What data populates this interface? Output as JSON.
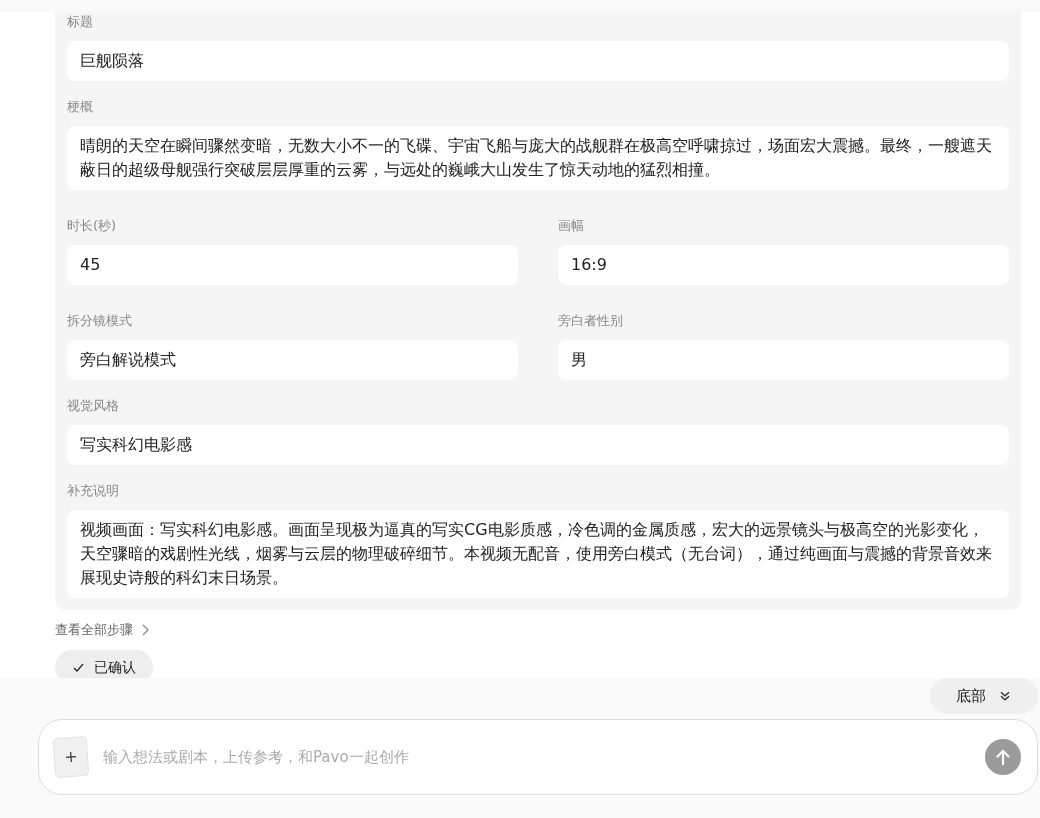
{
  "form": {
    "fields": [
      {
        "label": "标题",
        "value": "巨舰陨落",
        "kind": "full"
      },
      {
        "label": "梗概",
        "value": "晴朗的天空在瞬间骤然变暗，无数大小不一的飞碟、宇宙飞船与庞大的战舰群在极高空呼啸掠过，场面宏大震撼。最终，一艘遮天蔽日的超级母舰强行突破层层厚重的云雾，与远处的巍峨大山发生了惊天动地的猛烈相撞。",
        "kind": "full"
      },
      {
        "label": "时长(秒)",
        "value": "45",
        "kind": "half"
      },
      {
        "label": "画幅",
        "value": "16:9",
        "kind": "half"
      },
      {
        "label": "拆分镜模式",
        "value": "旁白解说模式",
        "kind": "half"
      },
      {
        "label": "旁白者性别",
        "value": "男",
        "kind": "half"
      },
      {
        "label": "视觉风格",
        "value": "写实科幻电影感",
        "kind": "full"
      },
      {
        "label": "补充说明",
        "value": "视频画面：写实科幻电影感。画面呈现极为逼真的写实CG电影质感，冷色调的金属质感，宏大的远景镜头与极高空的光影变化，天空骤暗的戏剧性光线，烟雾与云层的物理破碎细节。本视频无配音，使用旁白模式（无台词），通过纯画面与震撼的背景音效来展现史诗般的科幻末日场景。",
        "kind": "full"
      }
    ]
  },
  "view_all_steps": {
    "label": "查看全部步骤"
  },
  "status_chip": {
    "label": "已确认"
  },
  "scroll_bottom_button": {
    "label": "底部"
  },
  "composer": {
    "placeholder": "输入想法或剧本，上传参考，和Pavo一起创作",
    "send_button": {
      "disabled": true
    }
  }
}
